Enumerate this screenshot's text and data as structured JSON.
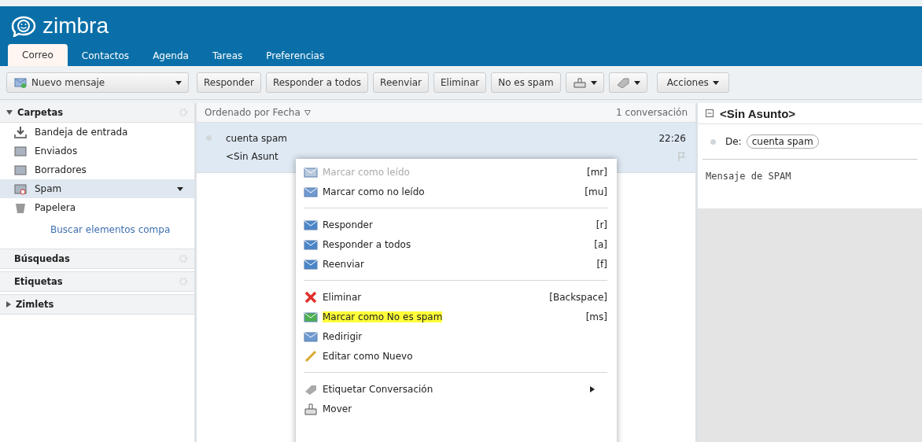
{
  "logo": {
    "text": "zimbra"
  },
  "tabs": [
    {
      "label": "Correo",
      "selected": true
    },
    {
      "label": "Contactos",
      "selected": false
    },
    {
      "label": "Agenda",
      "selected": false
    },
    {
      "label": "Tareas",
      "selected": false
    },
    {
      "label": "Preferencias",
      "selected": false
    }
  ],
  "toolbar": {
    "new_message": "Nuevo mensaje",
    "buttons": [
      {
        "label": "Responder",
        "kind": "text"
      },
      {
        "label": "Responder a todos",
        "kind": "text"
      },
      {
        "label": "Reenviar",
        "kind": "text"
      },
      {
        "label": "Eliminar",
        "kind": "text"
      },
      {
        "label": "No es spam",
        "kind": "text"
      },
      {
        "kind": "move"
      },
      {
        "kind": "tag"
      },
      {
        "label": "Acciones",
        "kind": "menu"
      }
    ]
  },
  "sidebar": {
    "folders_header": "Carpetas",
    "folders": [
      {
        "label": "Bandeja de entrada",
        "kind": "inbox",
        "selected": false
      },
      {
        "label": "Enviados",
        "kind": "sent",
        "selected": false
      },
      {
        "label": "Borradores",
        "kind": "drafts",
        "selected": false
      },
      {
        "label": "Spam",
        "kind": "spam",
        "selected": true
      },
      {
        "label": "Papelera",
        "kind": "trash",
        "selected": false
      }
    ],
    "search_link": "Buscar elementos compa",
    "sections": [
      {
        "label": "Búsquedas",
        "kind": "gear"
      },
      {
        "label": "Etiquetas",
        "kind": "gear"
      },
      {
        "label": "Zimlets",
        "kind": "collapsed"
      }
    ]
  },
  "list": {
    "sort_label": "Ordenado por Fecha",
    "count": "1 conversación",
    "rows": [
      {
        "sender": "cuenta spam",
        "subject": "<Sin Asunt",
        "time": "22:26",
        "selected": true
      }
    ]
  },
  "reading": {
    "title": "<Sin Asunto>",
    "from_label": "De:",
    "from": "cuenta spam",
    "body": "Mensaje de SPAM"
  },
  "context_menu": [
    {
      "kind": "read",
      "label": "Marcar como leído",
      "shortcut": "[mr]",
      "disabled": true,
      "highlighted": false
    },
    {
      "kind": "unread",
      "label": "Marcar como no leído",
      "shortcut": "[mu]",
      "disabled": false,
      "highlighted": false
    },
    {
      "kind": "separator"
    },
    {
      "kind": "reply",
      "label": "Responder",
      "shortcut": "[r]",
      "disabled": false,
      "highlighted": false
    },
    {
      "kind": "replyall",
      "label": "Responder a todos",
      "shortcut": "[a]",
      "disabled": false,
      "highlighted": false
    },
    {
      "kind": "forward",
      "label": "Reenviar",
      "shortcut": "[f]",
      "disabled": false,
      "highlighted": false
    },
    {
      "kind": "separator"
    },
    {
      "kind": "delete",
      "label": "Eliminar",
      "shortcut": "[Backspace]",
      "disabled": false,
      "highlighted": false
    },
    {
      "kind": "notspam",
      "label": "Marcar como No es spam",
      "shortcut": "[ms]",
      "disabled": false,
      "highlighted": true
    },
    {
      "kind": "redirect",
      "label": "Redirigir",
      "disabled": false,
      "highlighted": false
    },
    {
      "kind": "edit",
      "label": "Editar como Nuevo",
      "disabled": false,
      "highlighted": false
    },
    {
      "kind": "separator"
    },
    {
      "kind": "tag",
      "label": "Etiquetar Conversación",
      "submenu": true,
      "disabled": false,
      "highlighted": false
    },
    {
      "kind": "move",
      "label": "Mover",
      "disabled": false,
      "highlighted": false
    }
  ]
}
